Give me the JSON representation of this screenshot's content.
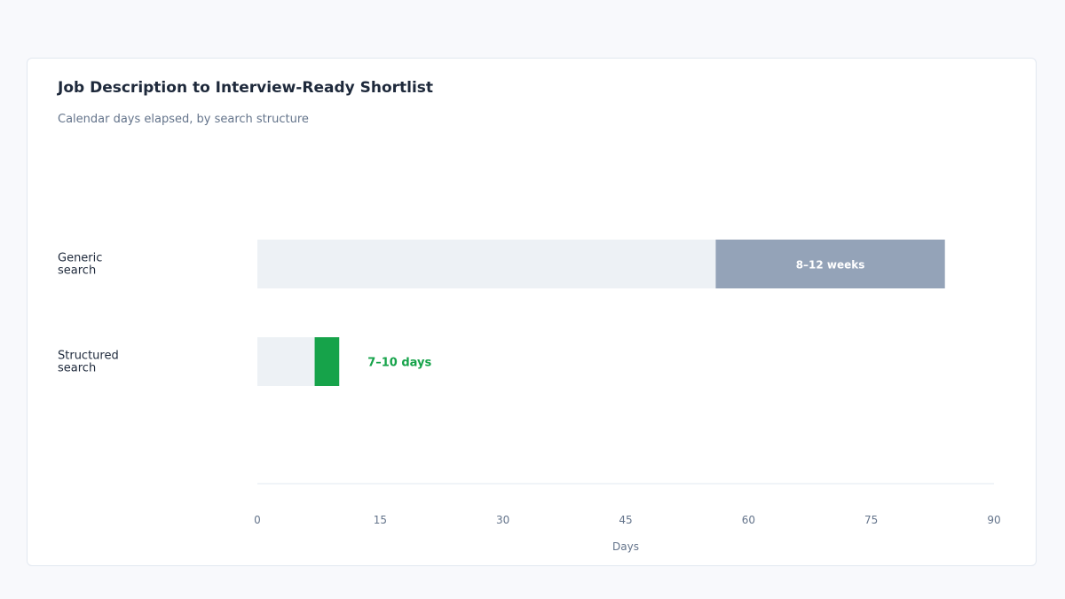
{
  "chart_data": {
    "type": "bar",
    "orientation": "horizontal",
    "title": "Job Description to Interview-Ready Shortlist",
    "subtitle": "Calendar days elapsed, by search structure",
    "xlabel": "Days",
    "ylabel": "",
    "xlim": [
      0,
      90
    ],
    "xticks": [
      0,
      15,
      30,
      45,
      60,
      75,
      90
    ],
    "grid": false,
    "legend": "none",
    "categories": [
      {
        "label": [
          "Generic",
          "search"
        ],
        "start": 56,
        "end": 84,
        "data_label": "8–12 weeks",
        "data_label_position": "inside"
      },
      {
        "label": [
          "Structured",
          "search"
        ],
        "start": 7,
        "end": 10,
        "data_label": "7–10 days",
        "data_label_position": "outside"
      }
    ]
  },
  "colors": {
    "track": "#edf1f5",
    "generic_bar": "#94a3b8",
    "structured_bar": "#16a34a",
    "generic_label": "#ffffff",
    "structured_label": "#16a34a",
    "axis_line": "#e2e8f0"
  }
}
